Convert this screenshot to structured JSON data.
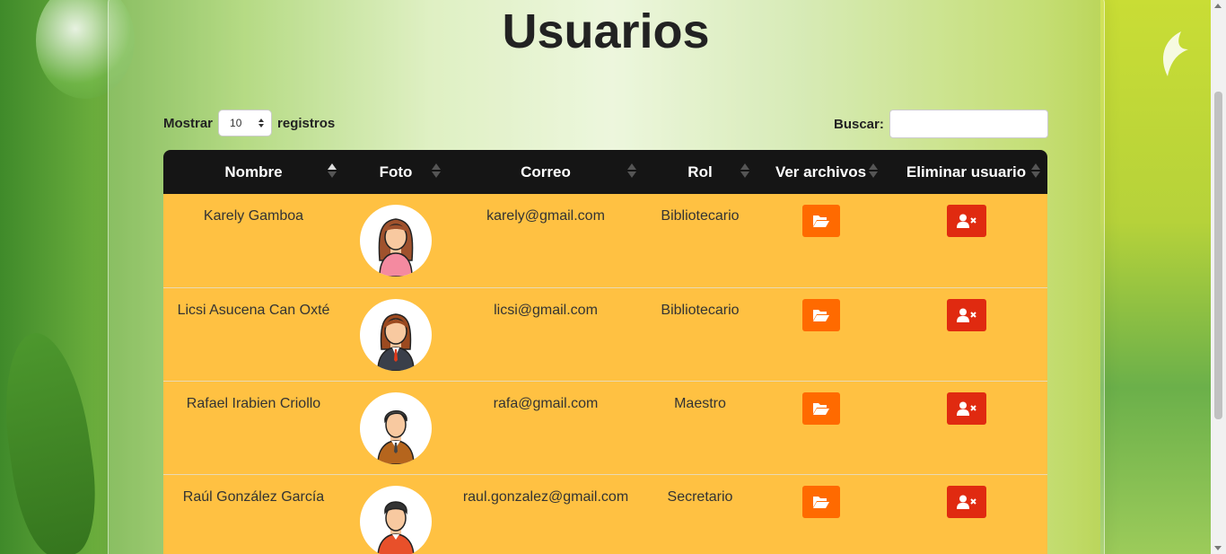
{
  "page": {
    "title": "Usuarios"
  },
  "controls": {
    "show_label": "Mostrar",
    "page_size": "10",
    "records_label": "registros",
    "search_label": "Buscar:",
    "search_value": ""
  },
  "table": {
    "columns": [
      "Nombre",
      "Foto",
      "Correo",
      "Rol",
      "Ver archivos",
      "Eliminar usuario"
    ],
    "rows": [
      {
        "name": "Karely Gamboa",
        "email": "karely@gmail.com",
        "role": "Bibliotecario",
        "avatar": "female-avatar-icon"
      },
      {
        "name": "Licsi Asucena Can Oxté",
        "email": "licsi@gmail.com",
        "role": "Bibliotecario",
        "avatar": "female-business-avatar-icon"
      },
      {
        "name": "Rafael Irabien Criollo",
        "email": "rafa@gmail.com",
        "role": "Maestro",
        "avatar": "male-business-avatar-icon"
      },
      {
        "name": "Raúl González García",
        "email": "raul.gonzalez@gmail.com",
        "role": "Secretario",
        "avatar": "male-avatar-icon"
      }
    ]
  },
  "colors": {
    "header_bg": "#151515",
    "row_bg": "#ffc142",
    "folder_button": "#ff6a00",
    "delete_button": "#e02a10"
  }
}
